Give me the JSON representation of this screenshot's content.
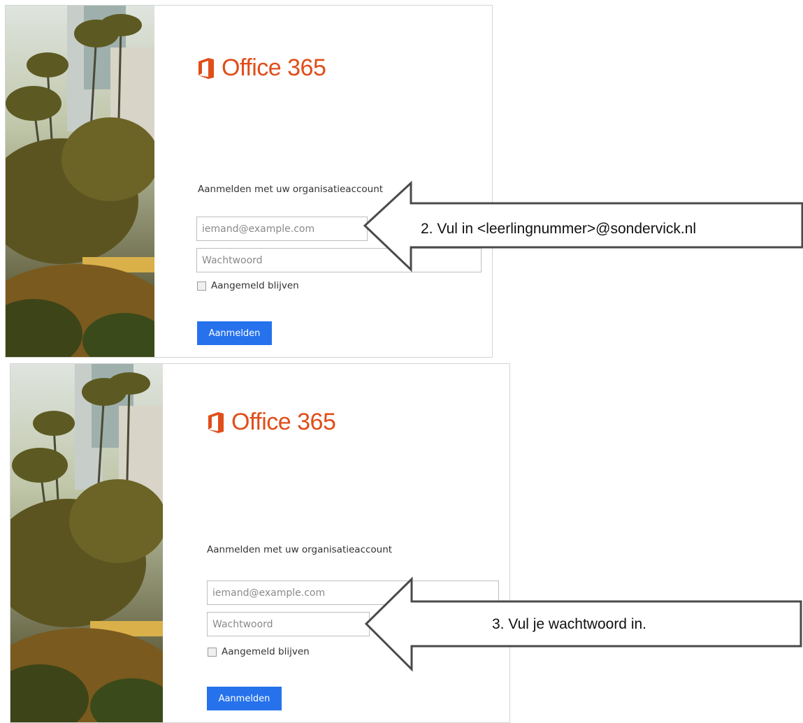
{
  "screens": [
    {
      "logo_text": "Office 365",
      "heading": "Aanmelden met uw organisatieaccount",
      "email_placeholder": "iemand@example.com",
      "password_placeholder": "Wachtwoord",
      "remember_label": "Aangemeld blijven",
      "signin_label": "Aanmelden"
    },
    {
      "logo_text": "Office 365",
      "heading": "Aanmelden met uw organisatieaccount",
      "email_placeholder": "iemand@example.com",
      "password_placeholder": "Wachtwoord",
      "remember_label": "Aangemeld blijven",
      "signin_label": "Aanmelden"
    }
  ],
  "annotations": [
    {
      "text": "2. Vul in <leerlingnummer>@sondervick.nl"
    },
    {
      "text": "3. Vul je wachtwoord in."
    }
  ],
  "colors": {
    "office_orange": "#e04e1a",
    "button_blue": "#2672ec",
    "arrow_stroke": "#4a4a4a"
  },
  "icons": {
    "logo": "office-logo-icon",
    "checkbox": "checkbox-icon",
    "arrow": "left-arrow-callout"
  }
}
